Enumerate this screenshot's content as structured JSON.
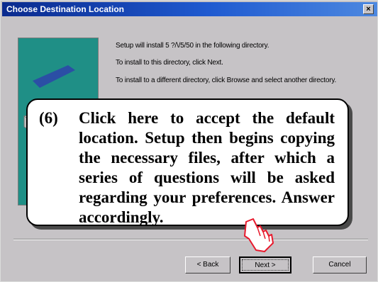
{
  "window": {
    "title": "Choose Destination Location",
    "close_glyph": "×"
  },
  "setup_text": [
    "Setup will install 5 ?/\\/5/50 in the following directory.",
    "To install to this directory, click Next.",
    "To install to a different directory, click Browse and select another directory."
  ],
  "callout": {
    "number": "(6)",
    "text": "Click here to accept the default location. Setup then begins copying the necessary files, after which a series of questions will be asked regarding your preferences. Answer accordingly."
  },
  "buttons": {
    "back": "< Back",
    "next": "Next >",
    "cancel": "Cancel"
  },
  "icons": [
    "close-icon",
    "setup-artwork-icon",
    "hand-pointer-icon"
  ]
}
